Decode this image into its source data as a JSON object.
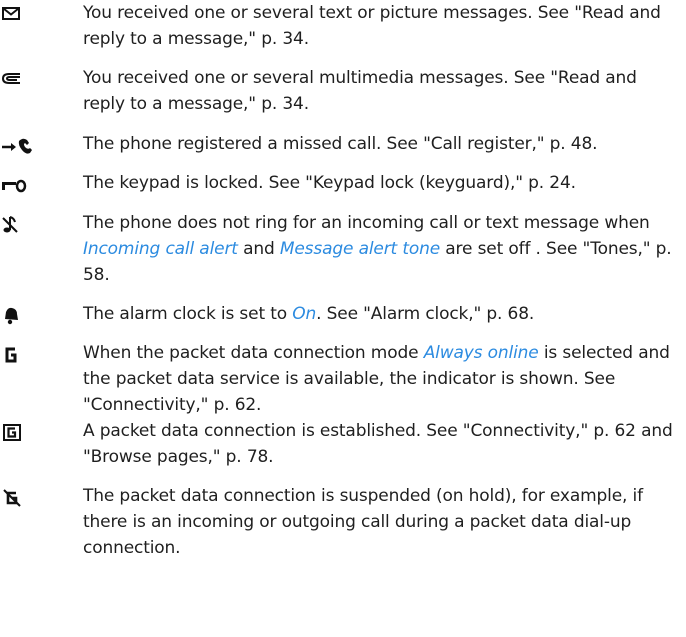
{
  "entries": [
    {
      "icon": "envelope-icon",
      "text": "You received one or several text or picture messages. See \"Read and reply to a message,\" p. 34."
    },
    {
      "icon": "multimedia-message-icon",
      "text": "You received one or several multimedia messages. See \"Read and reply to a message,\" p. 34."
    },
    {
      "icon": "missed-call-icon",
      "text": "The phone registered a missed call. See \"Call register,\" p. 48."
    },
    {
      "icon": "key-lock-icon",
      "text": "The keypad is locked. See \"Keypad lock (keyguard),\" p. 24."
    },
    {
      "icon": "silent-mode-icon",
      "text_a": "The phone does not ring for an incoming call or text message when ",
      "link_a": "Incoming call alert",
      "text_b": " and ",
      "link_b": "Message alert tone",
      "text_c": " are set off . See \"Tones,\" p. 58."
    },
    {
      "icon": "alarm-bell-icon",
      "text_a": "The alarm clock is set to ",
      "link_a": "On",
      "text_b": ". See \"Alarm clock,\" p. 68."
    },
    {
      "icon": "gprs-always-online-icon",
      "text_a": "When the packet data connection mode ",
      "link_a": "Always online",
      "text_b": " is selected and the packet data service is available, the indicator is shown. See \"Connectivity,\" p. 62."
    },
    {
      "icon": "gprs-connected-icon",
      "text": "A packet data connection is established. See \"Connectivity,\" p. 62 and \"Browse pages,\" p. 78."
    },
    {
      "icon": "gprs-suspended-icon",
      "text": "The packet data connection is suspended (on hold), for example, if there is an incoming or outgoing call during a packet data dial-up connection."
    }
  ],
  "colors": {
    "text": "#1f1f1f",
    "link": "#2c8be0",
    "icon": "#111111"
  }
}
